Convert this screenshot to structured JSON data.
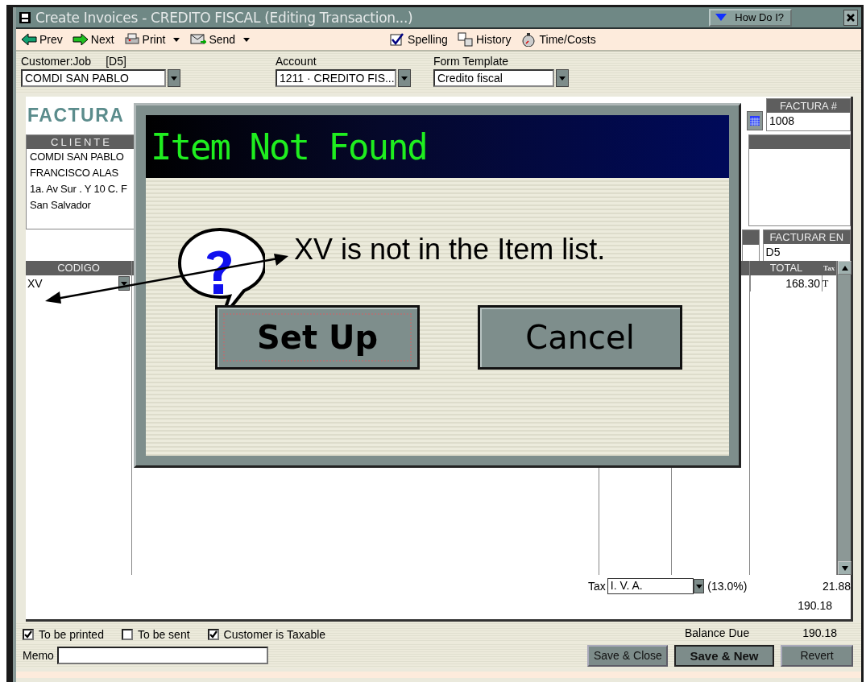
{
  "window": {
    "title": "Create Invoices - CREDITO FISCAL (Editing Transaction...)",
    "help_button": "How Do I?"
  },
  "toolbar": [
    {
      "kind": "prev",
      "label": "Prev",
      "dropdown": false
    },
    {
      "kind": "next",
      "label": "Next",
      "dropdown": false
    },
    {
      "kind": "print",
      "label": "Print",
      "dropdown": true
    },
    {
      "kind": "send",
      "label": "Send",
      "dropdown": true
    },
    {
      "kind": "spelling",
      "label": "Spelling",
      "dropdown": false
    },
    {
      "kind": "history",
      "label": "History",
      "dropdown": false
    },
    {
      "kind": "time",
      "label": "Time/Costs",
      "dropdown": false
    }
  ],
  "fields": [
    {
      "label": "Customer:Job",
      "tag": "[D5]",
      "value": "COMDI SAN PABLO"
    },
    {
      "label": "Account",
      "value": "1211 · CREDITO FIS..."
    },
    {
      "label": "Form Template",
      "value": "Credito fiscal"
    }
  ],
  "invoice": {
    "title": "FACTURA",
    "cliente": {
      "header": "CLIENTE",
      "lines": [
        "COMDI SAN PABLO",
        "FRANCISCO ALAS",
        "1a. Av Sur . Y 10 C. F",
        "San Salvador"
      ]
    },
    "factura_no": {
      "header": "FACTURA #",
      "value": "1008"
    },
    "facturar_en": {
      "header": "FACTURAR EN",
      "value": "D5"
    },
    "table": {
      "columns": [
        "CODIGO",
        "TOTAL",
        "Tax"
      ],
      "rows": [
        {
          "codigo": "XV",
          "total": "168.30",
          "tax": "T"
        }
      ]
    },
    "tax": {
      "label": "Tax",
      "value": "I. V. A.",
      "rate": "(13.0%)",
      "amount": "21.88"
    },
    "total": "190.18"
  },
  "options": [
    {
      "label": "To be printed",
      "checked": true
    },
    {
      "label": "To be sent",
      "checked": false
    },
    {
      "label": "Customer is Taxable",
      "checked": true
    }
  ],
  "balance": {
    "label": "Balance Due",
    "value": "190.18"
  },
  "memo": {
    "label": "Memo"
  },
  "buttons": [
    {
      "label": "Save & Close",
      "default": false
    },
    {
      "label": "Save & New",
      "default": true
    },
    {
      "label": "Revert",
      "default": false
    }
  ],
  "dialog": {
    "title": "Item Not Found",
    "message": "XV is not in the Item list.",
    "buttons": [
      {
        "label": "Set Up",
        "focused": true
      },
      {
        "label": "Cancel",
        "focused": false
      }
    ]
  }
}
